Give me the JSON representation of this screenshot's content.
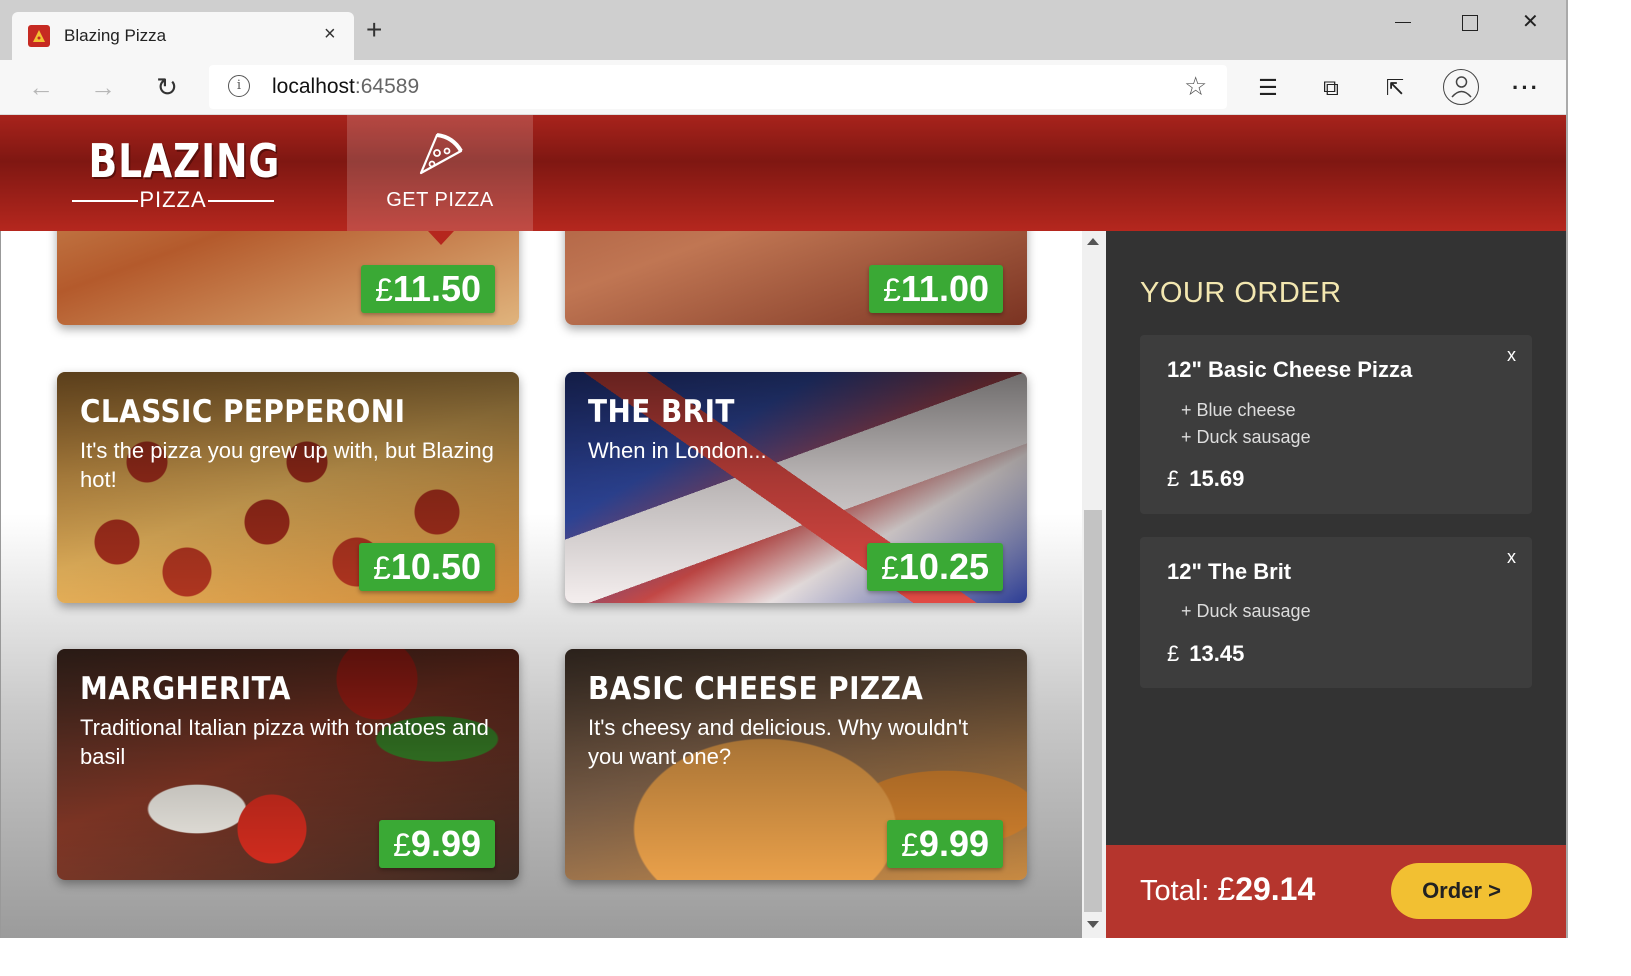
{
  "browser": {
    "tab_title": "Blazing Pizza",
    "tab_close": "×",
    "new_tab": "+",
    "url_host": "localhost",
    "url_port": ":64589",
    "window_close": "✕",
    "icons": [
      "back-arrow-icon",
      "forward-arrow-icon",
      "reload-icon",
      "info-icon",
      "star-icon",
      "favorites-icon",
      "collections-icon",
      "share-icon",
      "profile-icon",
      "more-icon"
    ]
  },
  "header": {
    "brand_title": "BLAZING",
    "brand_sub": "PIZZA",
    "nav_label": "GET PIZZA",
    "colors": {
      "header": "#9b1f18",
      "accent": "#3aa935",
      "order_button": "#f2c032"
    }
  },
  "specials": [
    {
      "name": "",
      "description": "",
      "currency": "£",
      "price": "11.50"
    },
    {
      "name": "",
      "description": "",
      "currency": "£",
      "price": "11.00"
    },
    {
      "name": "CLASSIC PEPPERONI",
      "description": "It's the pizza you grew up with, but Blazing hot!",
      "currency": "£",
      "price": "10.50"
    },
    {
      "name": "THE BRIT",
      "description": "When in London...",
      "currency": "£",
      "price": "10.25"
    },
    {
      "name": "MARGHERITA",
      "description": "Traditional Italian pizza with tomatoes and basil",
      "currency": "£",
      "price": "9.99"
    },
    {
      "name": "BASIC CHEESE PIZZA",
      "description": "It's cheesy and delicious. Why wouldn't you want one?",
      "currency": "£",
      "price": "9.99"
    }
  ],
  "order": {
    "title": "YOUR ORDER",
    "remove_label": "x",
    "items": [
      {
        "title": "12\" Basic Cheese Pizza",
        "toppings": [
          "+ Blue cheese",
          "+ Duck sausage"
        ],
        "currency": "£",
        "price": "15.69"
      },
      {
        "title": "12\" The Brit",
        "toppings": [
          "+ Duck sausage"
        ],
        "currency": "£",
        "price": "13.45"
      }
    ],
    "total_label": "Total:",
    "total_currency": "£",
    "total_value": "29.14",
    "order_button": "Order >"
  }
}
